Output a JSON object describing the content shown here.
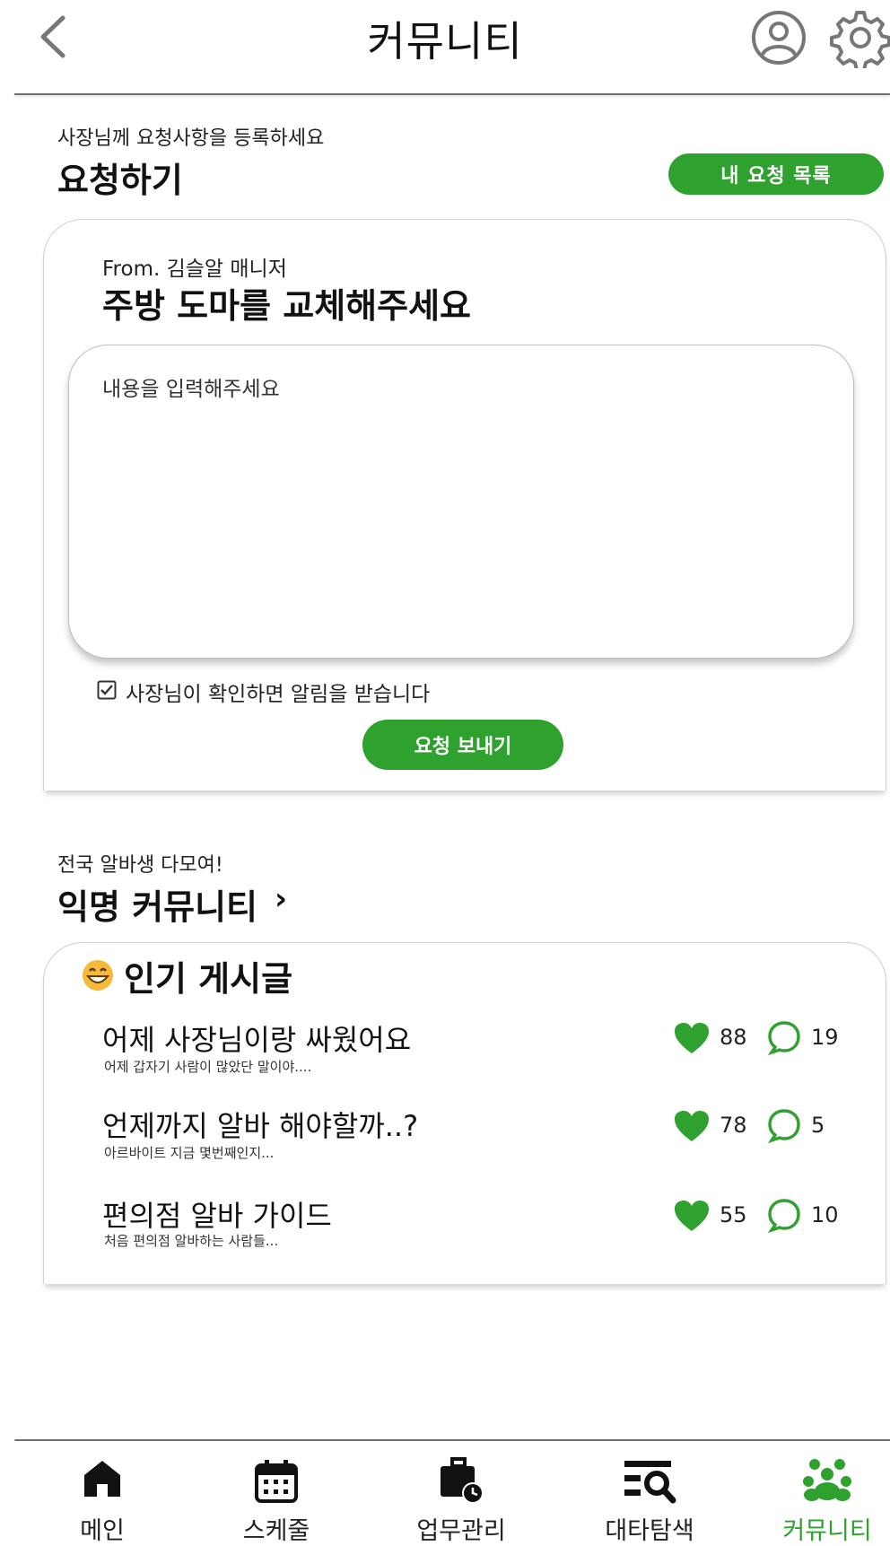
{
  "header": {
    "title": "커뮤니티",
    "back_icon": "chevron-left-icon",
    "profile_icon": "user-circle-icon",
    "settings_icon": "gear-icon"
  },
  "request": {
    "subtitle": "사장님께 요청사항을 등록하세요",
    "title": "요청하기",
    "my_requests_label": "내 요청 목록",
    "from": "From. 김슬알 매니저",
    "subject": "주방 도마를 교체해주세요",
    "content_placeholder": "내용을 입력해주세요",
    "notify_checked": true,
    "notify_label": "사장님이 확인하면 알림을 받습니다",
    "send_label": "요청 보내기"
  },
  "community": {
    "subtitle": "전국 알바생 다모여!",
    "title": "익명 커뮤니티",
    "chevron": "›",
    "popular_title": "인기 게시글",
    "popular_icon": "grinning-face-emoji",
    "posts": [
      {
        "title": "어제 사장님이랑 싸웠어요",
        "preview": "어제 갑자기 사람이 많았단 말이야....",
        "likes": "88",
        "comments": "19"
      },
      {
        "title": "언제까지 알바 해야할까..?",
        "preview": "아르바이트 지금 몇번째인지...",
        "likes": "78",
        "comments": "5"
      },
      {
        "title": "편의점 알바 가이드",
        "preview": "처음 편의점 알바하는 사람들...",
        "likes": "55",
        "comments": "10"
      }
    ]
  },
  "nav": {
    "items": [
      {
        "label": "메인",
        "icon": "home-icon"
      },
      {
        "label": "스케줄",
        "icon": "calendar-icon"
      },
      {
        "label": "업무관리",
        "icon": "briefcase-clock-icon"
      },
      {
        "label": "대타탐색",
        "icon": "list-search-icon"
      },
      {
        "label": "커뮤니티",
        "icon": "people-group-icon",
        "active": true
      }
    ]
  },
  "colors": {
    "accent": "#2fa12f",
    "text": "#111111",
    "divider": "#6e6e6e"
  }
}
